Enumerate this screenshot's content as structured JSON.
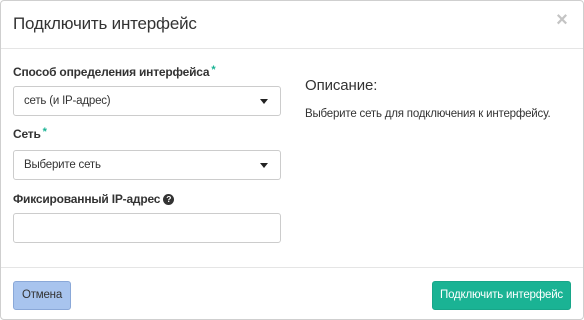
{
  "dialog": {
    "title": "Подключить интерфейс",
    "close_glyph": "×"
  },
  "form": {
    "interface_method": {
      "label": "Способ определения интерфейса",
      "required_mark": "*",
      "selected": "сеть (и IP-адрес)"
    },
    "network": {
      "label": "Сеть",
      "required_mark": "*",
      "selected": "Выберите сеть"
    },
    "fixed_ip": {
      "label": "Фиксированный IP-адрес",
      "help_glyph": "?",
      "value": ""
    }
  },
  "description": {
    "title": "Описание:",
    "text": "Выберите сеть для подключения к интерфейсу."
  },
  "footer": {
    "cancel_label": "Отмена",
    "submit_label": "Подключить интерфейс"
  },
  "colors": {
    "accent": "#1ab394",
    "cancel_bg": "#a8c4ee"
  }
}
